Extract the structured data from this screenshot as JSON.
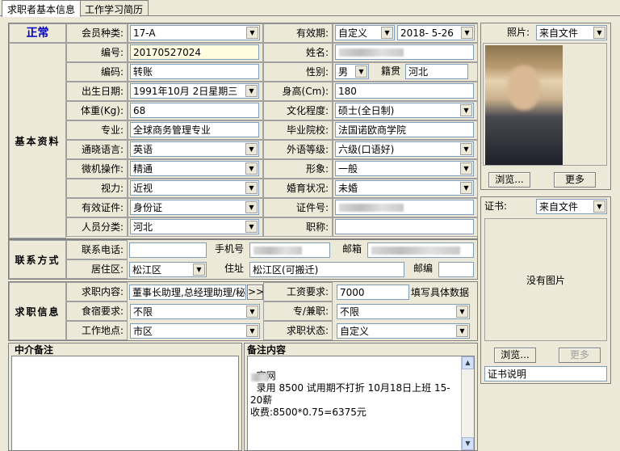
{
  "tabs": [
    "求职者基本信息",
    "工作学习简历"
  ],
  "status": "正常",
  "member_type": {
    "label": "会员种类:",
    "value": "17-A"
  },
  "validity": {
    "label": "有效期:",
    "mode": "自定义",
    "date": "2018- 5-26"
  },
  "photo": {
    "label": "照片:",
    "source": "来自文件",
    "browse": "浏览...",
    "more": "更多"
  },
  "basic_section": "基本资料",
  "fields": {
    "id_no": {
      "label": "编号:",
      "value": "20170527024"
    },
    "name": {
      "label": "姓名:",
      "value": ""
    },
    "code": {
      "label": "编码:",
      "value": "转账"
    },
    "gender": {
      "label": "性别:",
      "value": "男"
    },
    "origin": {
      "label": "籍贯",
      "value": "河北"
    },
    "birth": {
      "label": "出生日期:",
      "value": "1991年10月 2日星期三"
    },
    "height": {
      "label": "身高(Cm):",
      "value": "180"
    },
    "weight": {
      "label": "体重(Kg):",
      "value": "68"
    },
    "education": {
      "label": "文化程度:",
      "value": "硕士(全日制)"
    },
    "major": {
      "label": "专业:",
      "value": "全球商务管理专业"
    },
    "school": {
      "label": "毕业院校:",
      "value": "法国诺欧商学院"
    },
    "language": {
      "label": "通晓语言:",
      "value": "英语"
    },
    "lang_level": {
      "label": "外语等级:",
      "value": "六级(口语好)"
    },
    "computer": {
      "label": "微机操作:",
      "value": "精通"
    },
    "image": {
      "label": "形象:",
      "value": "一般"
    },
    "vision": {
      "label": "视力:",
      "value": "近视"
    },
    "marital": {
      "label": "婚育状况:",
      "value": "未婚"
    },
    "cert_type": {
      "label": "有效证件:",
      "value": "身份证"
    },
    "cert_no": {
      "label": "证件号:",
      "value": ""
    },
    "person_class": {
      "label": "人员分类:",
      "value": "河北"
    },
    "title": {
      "label": "职称:",
      "value": ""
    }
  },
  "contact_section": "联系方式",
  "contact": {
    "phone_label": "联系电话:",
    "phone": "",
    "mobile_label": "手机号",
    "mobile": "",
    "email_label": "邮箱",
    "email": "",
    "district_label": "居住区:",
    "district": "松江区",
    "address_label": "住址",
    "address": "松江区(可搬迁)",
    "zip_label": "邮编",
    "zip": ""
  },
  "job_section": "求职信息",
  "job": {
    "content_label": "求职内容:",
    "content": "董事长助理,总经理助理/秘",
    "more_btn": ">>",
    "salary_label": "工资要求:",
    "salary": "7000",
    "salary_hint": "填写具体数据",
    "board_label": "食宿要求:",
    "board": "不限",
    "parttime_label": "专/兼职:",
    "parttime": "不限",
    "location_label": "工作地点:",
    "location": "市区",
    "status_label": "求职状态:",
    "status": "自定义"
  },
  "cert": {
    "label": "证书:",
    "source": "来自文件",
    "no_image": "没有图片",
    "browse": "浏览...",
    "more": "更多",
    "desc": "证书说明"
  },
  "agent_note": {
    "title": "中介备注",
    "text": ""
  },
  "remark": {
    "title": "备注内容",
    "text": "官网\n  录用 8500 试用期不打折 10月18日上班 15-20薪\n收费:8500*0.75=6375元"
  }
}
